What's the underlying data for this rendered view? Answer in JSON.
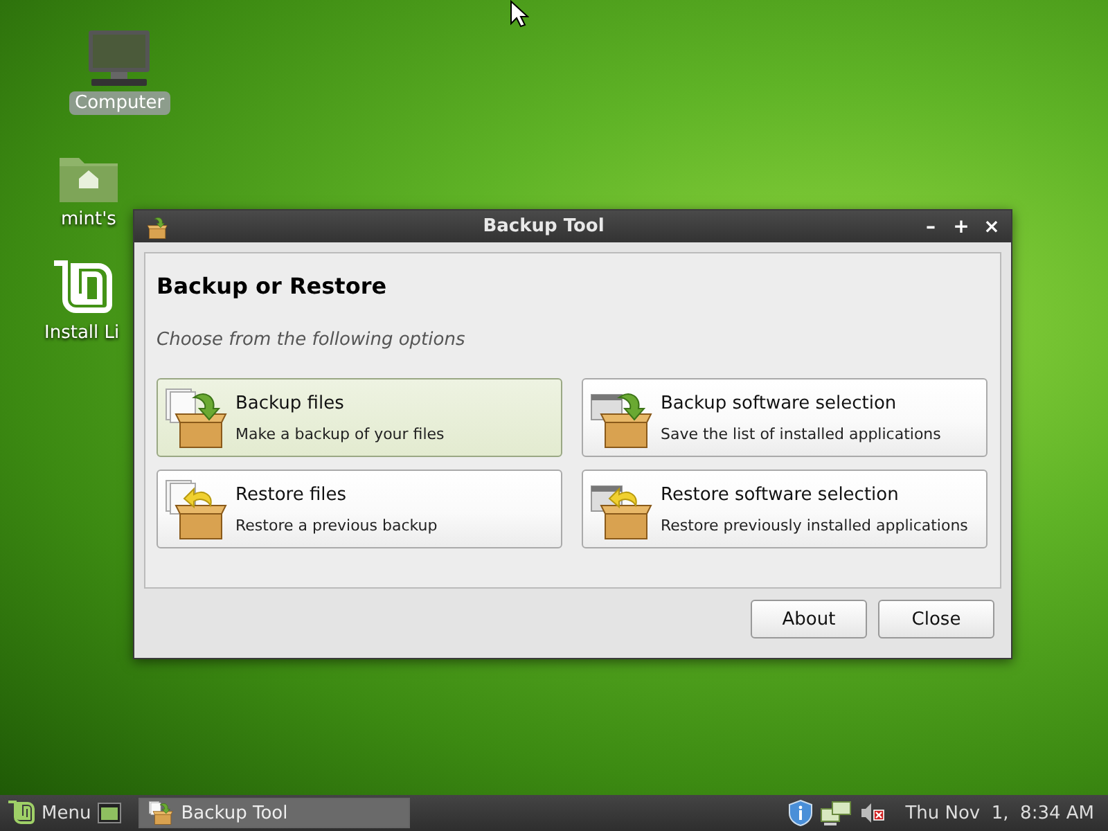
{
  "desktop_icons": [
    {
      "label": "Computer",
      "kind": "computer",
      "selected": true
    },
    {
      "label": "mint's",
      "kind": "home",
      "selected": false
    },
    {
      "label": "Install Li",
      "kind": "mint",
      "selected": false
    }
  ],
  "window": {
    "title": "Backup Tool",
    "controls": [
      "–",
      "+",
      "×"
    ],
    "heading": "Backup or Restore",
    "subtitle": "Choose from the following options",
    "options": [
      {
        "title": "Backup files",
        "description": "Make a backup of your files",
        "kind": "files_backup",
        "selected": true
      },
      {
        "title": "Backup software selection",
        "description": "Save the list of installed applications",
        "kind": "software_backup",
        "selected": false
      },
      {
        "title": "Restore files",
        "description": "Restore a previous backup",
        "kind": "files_restore",
        "selected": false
      },
      {
        "title": "Restore software selection",
        "description": "Restore previously installed applications",
        "kind": "software_restore",
        "selected": false
      }
    ],
    "buttons": [
      "About",
      "Close"
    ]
  },
  "taskbar": {
    "menu_label": "Menu",
    "tasks": [
      {
        "label": "Backup Tool",
        "selected": true
      }
    ],
    "clock": "Thu Nov  1,  8:34 AM"
  }
}
